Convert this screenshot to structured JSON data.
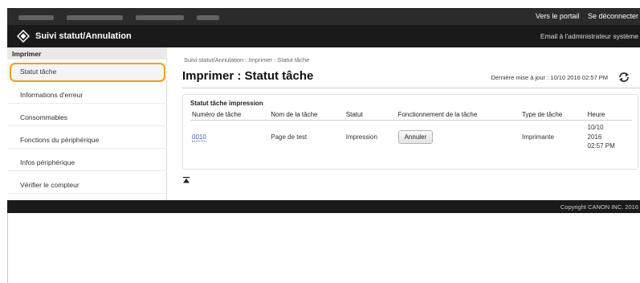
{
  "header": {
    "portal_link": "Vers le portail",
    "logout_link": "Se déconnecter",
    "app_title": "Suivi statut/Annulation",
    "admin_mail": "Email à l'administrateur système"
  },
  "sidebar": {
    "section": "Imprimer",
    "items": [
      {
        "label": "Statut tâche"
      },
      {
        "label": "Informations d'erreur"
      },
      {
        "label": "Consommables"
      },
      {
        "label": "Fonctions du périphérique"
      },
      {
        "label": "Infos périphérique"
      },
      {
        "label": "Vérifier le compteur"
      }
    ]
  },
  "main": {
    "breadcrumb": "Suivi statut/Annulation : Imprimer : Statut tâche",
    "title": "Imprimer : Statut tâche",
    "last_update": "Dernière mise à jour : 10/10 2016 02:57 PM",
    "panel_title": "Statut tâche impression",
    "columns": [
      "Numéro de tâche",
      "Nom de la tâche",
      "Statut",
      "Fonctionnement de la tâche",
      "Type de tâche",
      "Heure"
    ],
    "rows": [
      {
        "job_number": "0010",
        "job_name": "Page de test",
        "status": "Impression",
        "action": "Annuler",
        "job_type": "Imprimante",
        "time_line1": "10/10",
        "time_line2": "2016",
        "time_line3": "02:57 PM"
      }
    ]
  },
  "footer": {
    "copyright": "Copyright CANON INC. 2016"
  }
}
